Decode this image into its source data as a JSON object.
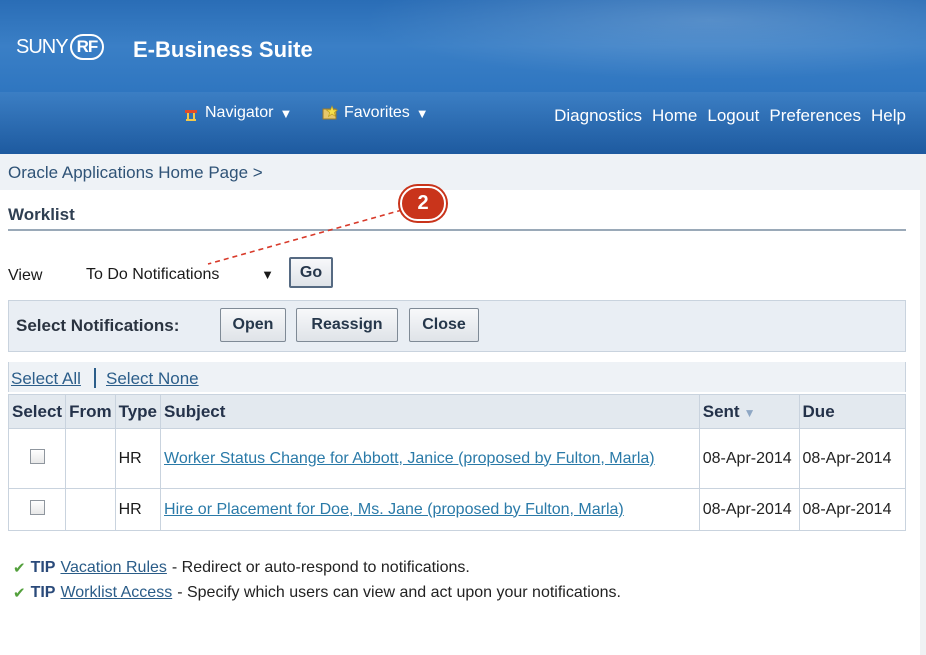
{
  "header": {
    "logo_suny": "SUNY",
    "logo_rf": "RF",
    "suite_title": "E-Business Suite",
    "navigator_label": "Navigator",
    "favorites_label": "Favorites",
    "links": [
      "Diagnostics",
      "Home",
      "Logout",
      "Preferences",
      "Help"
    ]
  },
  "breadcrumb": {
    "link": "Oracle Applications Home Page",
    "separator": ">"
  },
  "page_title": "Worklist",
  "view": {
    "label": "View",
    "selected": "To Do Notifications",
    "go_label": "Go"
  },
  "select_notifications": {
    "label": "Select Notifications:",
    "buttons": [
      "Open",
      "Reassign",
      "Close"
    ]
  },
  "select_all": "Select All",
  "select_none": "Select None",
  "table": {
    "headers": [
      "Select",
      "From",
      "Type",
      "Subject",
      "Sent",
      "Due"
    ],
    "rows": [
      {
        "from": "",
        "type": "HR",
        "subject": "Worker Status Change for Abbott, Janice (proposed by Fulton, Marla)",
        "sent": "08-Apr-2014",
        "due": "08-Apr-2014"
      },
      {
        "from": "",
        "type": "HR",
        "subject": "Hire or Placement for Doe, Ms. Jane (proposed by Fulton, Marla)",
        "sent": "08-Apr-2014",
        "due": "08-Apr-2014"
      }
    ]
  },
  "tips": [
    {
      "word": "TIP",
      "link": "Vacation Rules",
      "text": "- Redirect or auto-respond to notifications."
    },
    {
      "word": "TIP",
      "link": "Worklist Access",
      "text": "- Specify which users can view and act upon your notifications."
    }
  ],
  "callout": {
    "number": "2",
    "color": "#c9341b"
  },
  "colors": {
    "header_blue": "#2f76c0",
    "link_blue": "#2a7aa8",
    "tip_green": "#53a03c"
  },
  "icons": {
    "navigator": "house-icon",
    "favorites": "star-folder-icon",
    "sort": "sort-desc-icon",
    "tip": "checkmark-icon"
  }
}
